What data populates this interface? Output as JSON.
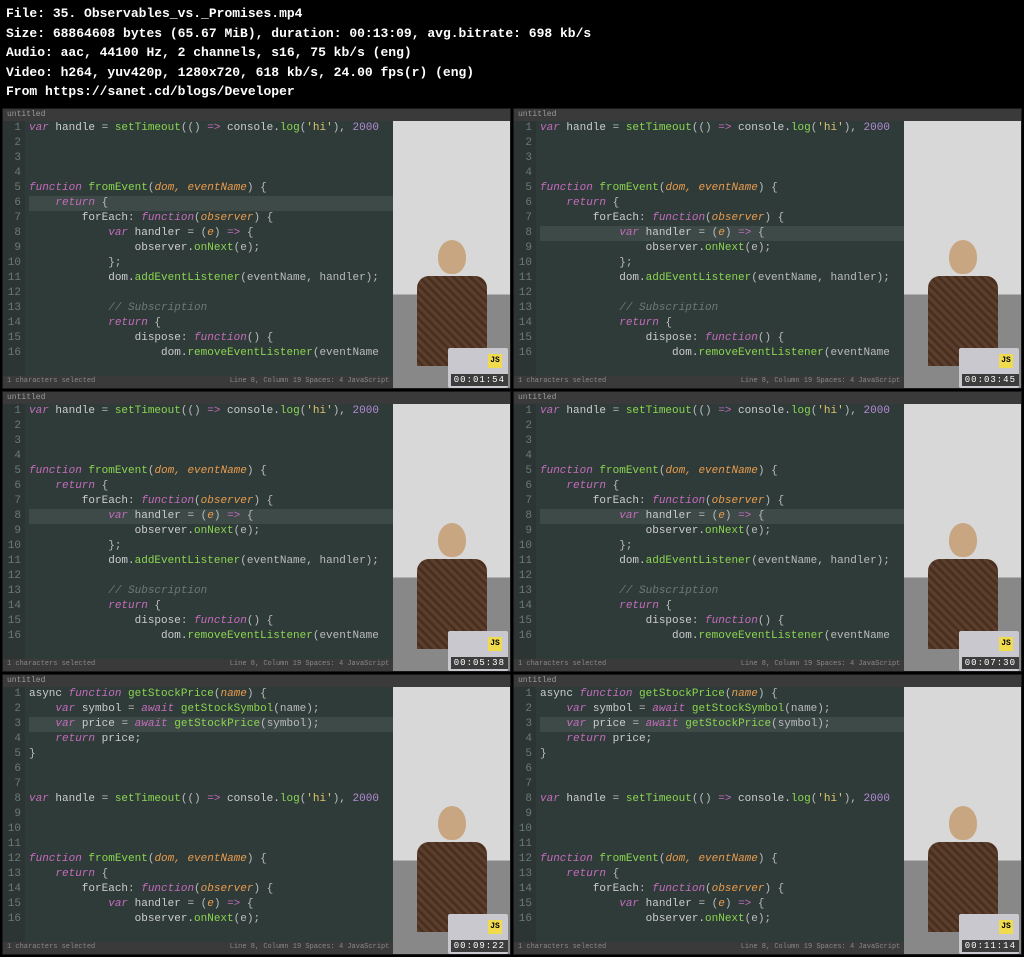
{
  "header": {
    "file_label": "File:",
    "file_name": "35. Observables_vs._Promises.mp4",
    "size_label": "Size:",
    "size_bytes": "68864608 bytes (65.67 MiB),",
    "duration_label": "duration:",
    "duration": "00:13:09,",
    "bitrate_label": "avg.bitrate:",
    "bitrate": "698 kb/s",
    "audio_label": "Audio:",
    "audio": "aac, 44100 Hz, 2 channels, s16, 75 kb/s (eng)",
    "video_label": "Video:",
    "video": "h264, yuv420p, 1280x720, 618 kb/s, 24.00 fps(r) (eng)",
    "from_label": "From",
    "from": "https://sanet.cd/blogs/Developer"
  },
  "tab": "untitled",
  "status": {
    "left": "1 characters selected",
    "right": "Line 8, Column 19    Spaces: 4    JavaScript"
  },
  "timestamps": [
    "00:01:54",
    "00:03:45",
    "00:05:38",
    "00:07:30",
    "00:09:22",
    "00:11:14"
  ],
  "js_badge": "JS",
  "code_a_lines": [
    [
      [
        "kw",
        "var"
      ],
      [
        "prop",
        " handle "
      ],
      [
        "op",
        "= "
      ],
      [
        "fn",
        "setTimeout"
      ],
      [
        "op",
        "(() "
      ],
      [
        "kw",
        "=>"
      ],
      [
        "prop",
        " console."
      ],
      [
        "fn",
        "log"
      ],
      [
        "op",
        "("
      ],
      [
        "str",
        "'hi'"
      ],
      [
        "op",
        "), "
      ],
      [
        "num",
        "2000"
      ]
    ],
    [],
    [],
    [],
    [
      [
        "kw",
        "function "
      ],
      [
        "fn",
        "fromEvent"
      ],
      [
        "op",
        "("
      ],
      [
        "param",
        "dom, eventName"
      ],
      [
        "op",
        ") {"
      ]
    ],
    [
      [
        "prop",
        "    "
      ],
      [
        "kw",
        "return"
      ],
      [
        "op",
        " {"
      ]
    ],
    [
      [
        "prop",
        "        forEach"
      ],
      [
        "op",
        ": "
      ],
      [
        "kw",
        "function"
      ],
      [
        "op",
        "("
      ],
      [
        "param",
        "observer"
      ],
      [
        "op",
        ") {"
      ]
    ],
    [
      [
        "prop",
        "            "
      ],
      [
        "kw",
        "var"
      ],
      [
        "prop",
        " handler "
      ],
      [
        "op",
        "= ("
      ],
      [
        "param",
        "e"
      ],
      [
        "op",
        ") "
      ],
      [
        "kw",
        "=>"
      ],
      [
        "op",
        " {"
      ]
    ],
    [
      [
        "prop",
        "                observer."
      ],
      [
        "fn",
        "onNext"
      ],
      [
        "op",
        "(e);"
      ]
    ],
    [
      [
        "op",
        "            };"
      ]
    ],
    [
      [
        "prop",
        "            dom."
      ],
      [
        "fn",
        "addEventListener"
      ],
      [
        "op",
        "(eventName, handler);"
      ]
    ],
    [],
    [
      [
        "comment",
        "            // Subscription"
      ]
    ],
    [
      [
        "prop",
        "            "
      ],
      [
        "kw",
        "return"
      ],
      [
        "op",
        " {"
      ]
    ],
    [
      [
        "prop",
        "                dispose"
      ],
      [
        "op",
        ": "
      ],
      [
        "kw",
        "function"
      ],
      [
        "op",
        "() {"
      ]
    ],
    [
      [
        "prop",
        "                    dom."
      ],
      [
        "fn",
        "removeEventListener"
      ],
      [
        "op",
        "(eventName"
      ]
    ]
  ],
  "code_b_lines": [
    [
      [
        "prop",
        "async "
      ],
      [
        "kw",
        "function "
      ],
      [
        "fn",
        "getStockPrice"
      ],
      [
        "op",
        "("
      ],
      [
        "param",
        "name"
      ],
      [
        "op",
        ") {"
      ]
    ],
    [
      [
        "prop",
        "    "
      ],
      [
        "kw",
        "var"
      ],
      [
        "prop",
        " symbol "
      ],
      [
        "op",
        "= "
      ],
      [
        "kw",
        "await"
      ],
      [
        "prop",
        " "
      ],
      [
        "fn",
        "getStockSymbol"
      ],
      [
        "op",
        "(name);"
      ]
    ],
    [
      [
        "prop",
        "    "
      ],
      [
        "kw",
        "var"
      ],
      [
        "prop",
        " price "
      ],
      [
        "op",
        "= "
      ],
      [
        "kw",
        "await"
      ],
      [
        "prop",
        " "
      ],
      [
        "fn",
        "getStockPrice"
      ],
      [
        "op",
        "(symbol);"
      ]
    ],
    [
      [
        "prop",
        "    "
      ],
      [
        "kw",
        "return"
      ],
      [
        "prop",
        " price;"
      ]
    ],
    [
      [
        "op",
        "}"
      ]
    ],
    [],
    [],
    [
      [
        "kw",
        "var"
      ],
      [
        "prop",
        " handle "
      ],
      [
        "op",
        "= "
      ],
      [
        "fn",
        "setTimeout"
      ],
      [
        "op",
        "(() "
      ],
      [
        "kw",
        "=>"
      ],
      [
        "prop",
        " console."
      ],
      [
        "fn",
        "log"
      ],
      [
        "op",
        "("
      ],
      [
        "str",
        "'hi'"
      ],
      [
        "op",
        "), "
      ],
      [
        "num",
        "2000"
      ]
    ],
    [],
    [],
    [],
    [
      [
        "kw",
        "function "
      ],
      [
        "fn",
        "fromEvent"
      ],
      [
        "op",
        "("
      ],
      [
        "param",
        "dom, eventName"
      ],
      [
        "op",
        ") {"
      ]
    ],
    [
      [
        "prop",
        "    "
      ],
      [
        "kw",
        "return"
      ],
      [
        "op",
        " {"
      ]
    ],
    [
      [
        "prop",
        "        forEach"
      ],
      [
        "op",
        ": "
      ],
      [
        "kw",
        "function"
      ],
      [
        "op",
        "("
      ],
      [
        "param",
        "observer"
      ],
      [
        "op",
        ") {"
      ]
    ],
    [
      [
        "prop",
        "            "
      ],
      [
        "kw",
        "var"
      ],
      [
        "prop",
        " handler "
      ],
      [
        "op",
        "= ("
      ],
      [
        "param",
        "e"
      ],
      [
        "op",
        ") "
      ],
      [
        "kw",
        "=>"
      ],
      [
        "op",
        " {"
      ]
    ],
    [
      [
        "prop",
        "                observer."
      ],
      [
        "fn",
        "onNext"
      ],
      [
        "op",
        "(e);"
      ]
    ]
  ],
  "frames": [
    {
      "code": "a",
      "hl": 6
    },
    {
      "code": "a",
      "hl": 8
    },
    {
      "code": "a",
      "hl": 8
    },
    {
      "code": "a",
      "hl": 8
    },
    {
      "code": "b",
      "hl": 3
    },
    {
      "code": "b",
      "hl": 3
    }
  ]
}
